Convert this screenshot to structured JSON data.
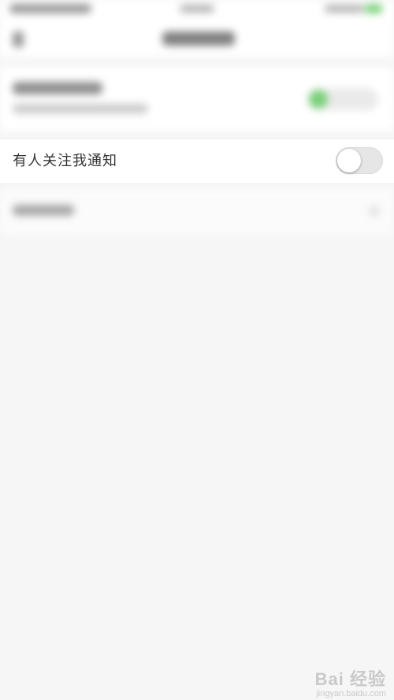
{
  "notify_row": {
    "label": "有人关注我通知",
    "toggle_on": false
  },
  "watermark": {
    "brand": "Bai 经验",
    "url": "jingyan.baidu.com"
  },
  "colors": {
    "background": "#f6f6f6",
    "toggle_off": "#e6e6e6",
    "accent_green": "#7ad07a"
  }
}
